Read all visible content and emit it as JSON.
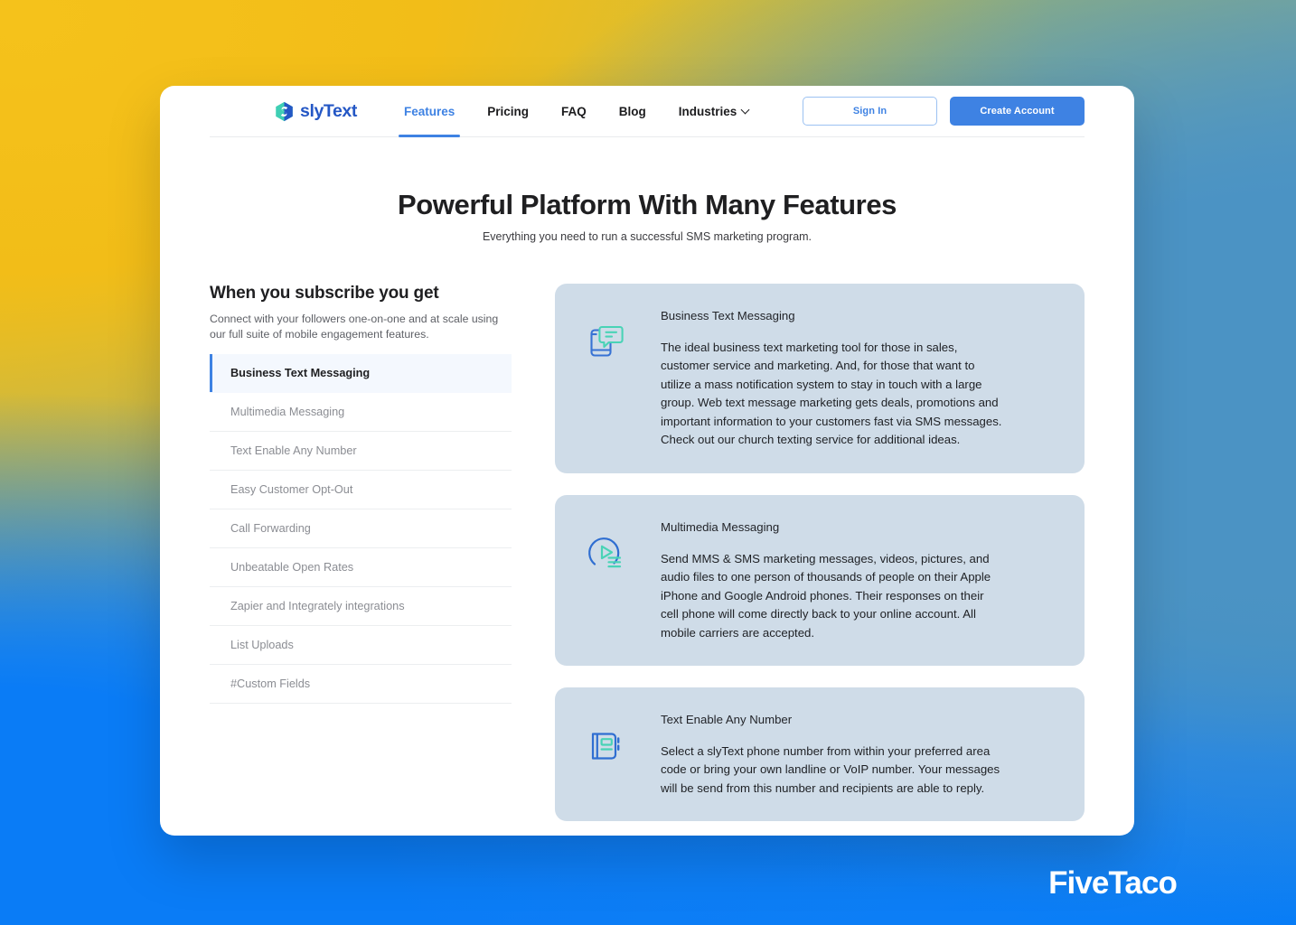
{
  "background": {
    "corner_top_left": "#f2bd18",
    "corner_top_right": "#4b93c4",
    "corner_bottom_left": "#0a7cf6",
    "corner_bottom_right": "#0a7cf6",
    "accent_green": "#6f9e86"
  },
  "nav": {
    "logo_text": "slyText",
    "logo_colors": {
      "hex_teal": "#3fcfb4",
      "hex_blue": "#2457c5"
    },
    "links": [
      {
        "label": "Features",
        "active": true
      },
      {
        "label": "Pricing",
        "active": false
      },
      {
        "label": "FAQ",
        "active": false
      },
      {
        "label": "Blog",
        "active": false
      },
      {
        "label": "Industries",
        "active": false,
        "has_caret": true
      }
    ],
    "sign_in_label": "Sign In",
    "create_account_label": "Create Account",
    "accent_color": "#3e82e3"
  },
  "hero": {
    "title": "Powerful Platform With Many Features",
    "subtitle": "Everything you need to run a successful SMS marketing program."
  },
  "sidebar": {
    "heading": "When you subscribe you get",
    "lede": "Connect with your followers one-on-one and at scale using our full suite of mobile engagement features.",
    "items": [
      {
        "label": "Business Text Messaging",
        "active": true
      },
      {
        "label": "Multimedia Messaging",
        "active": false
      },
      {
        "label": "Text Enable Any Number",
        "active": false
      },
      {
        "label": "Easy Customer Opt-Out",
        "active": false
      },
      {
        "label": "Call Forwarding",
        "active": false
      },
      {
        "label": "Unbeatable Open Rates",
        "active": false
      },
      {
        "label": "Zapier and Integrately integrations",
        "active": false
      },
      {
        "label": "List Uploads",
        "active": false
      },
      {
        "label": "#Custom Fields",
        "active": false
      }
    ]
  },
  "cards": [
    {
      "icon": "phone-chat-icon",
      "title": "Business Text Messaging",
      "text": "The ideal business text marketing tool for those in sales, customer service and marketing. And, for those that want to utilize a mass notification system to stay in touch with a large group. Web text message marketing gets deals, promotions and important information to your customers fast via SMS messages. Check out our church texting service for additional ideas."
    },
    {
      "icon": "media-play-icon",
      "title": "Multimedia Messaging",
      "text": "Send MMS & SMS marketing messages, videos, pictures, and audio files to one person of thousands of people on their Apple iPhone and Google Android phones. Their responses on their cell phone will come directly back to your online account. All mobile carriers are accepted."
    },
    {
      "icon": "notebook-icon",
      "title": "Text Enable Any Number",
      "text": "Select a slyText phone number from within your preferred area code or bring your own landline or VoIP number. Your messages will be send from this number and recipients are able to reply."
    }
  ],
  "watermark": {
    "label": "FiveTaco"
  }
}
